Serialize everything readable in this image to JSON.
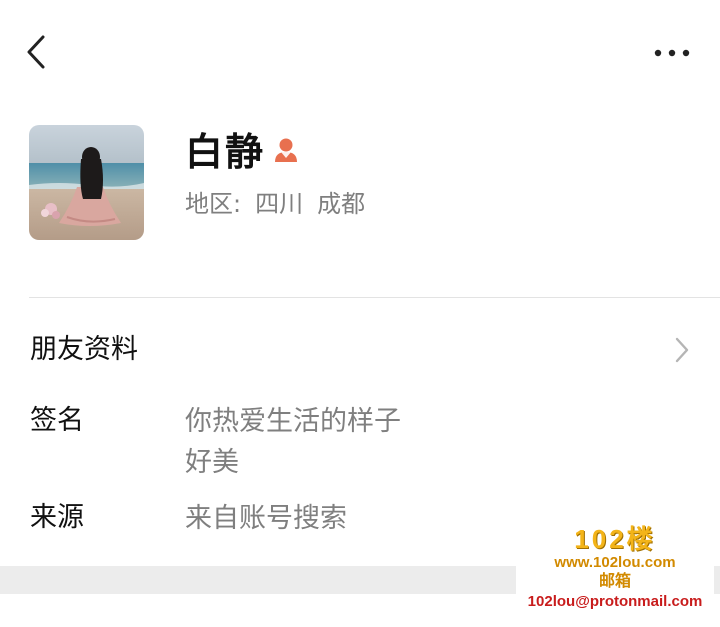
{
  "top_bar": {
    "back_icon": "chevron-left-icon",
    "more_icon": "more-dots-icon"
  },
  "profile": {
    "avatar_description": "avatar-photo",
    "name": "白静",
    "gender_icon": "female-user-icon",
    "gender_color": "#e8704f",
    "region_label": "地区:",
    "region_province": "四川",
    "region_city": "成都"
  },
  "friend_info": {
    "label": "朋友资料",
    "chevron_icon": "chevron-right-icon"
  },
  "signature": {
    "label": "签名",
    "value_line1": "你热爱生活的样子",
    "value_line2": "好美"
  },
  "source": {
    "label": "来源",
    "value": "来自账号搜索"
  },
  "watermark": {
    "brand": "102楼",
    "url": "www.102lou.com",
    "mail_label": "邮箱",
    "email": "102lou@protonmail.com"
  },
  "colors": {
    "text_primary": "#111111",
    "text_secondary": "#7f7f7f",
    "divider": "#e3e3e3",
    "band": "#ececec"
  }
}
